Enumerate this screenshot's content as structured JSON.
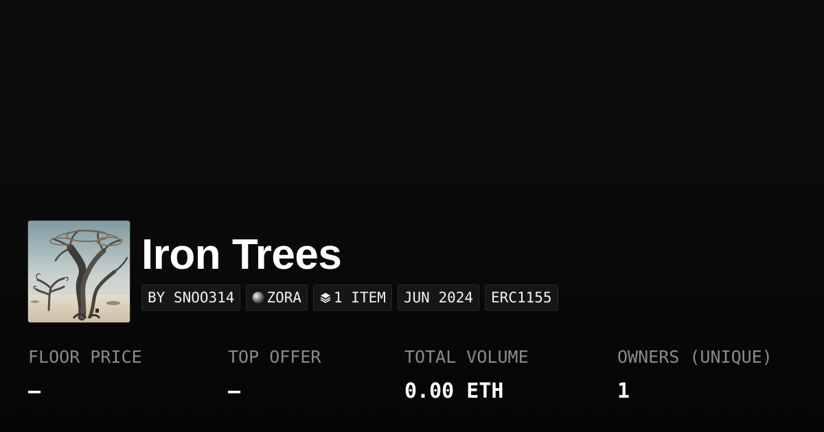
{
  "collection": {
    "name": "Iron Trees"
  },
  "tags": {
    "creator": "BY SNOO314",
    "chain": "ZORA",
    "items": "1 ITEM",
    "date": "JUN 2024",
    "standard": "ERC1155"
  },
  "icons": {
    "chain": "zora-orb-icon",
    "items": "layers-icon"
  },
  "stats": [
    {
      "label": "FLOOR PRICE",
      "value": "—"
    },
    {
      "label": "TOP OFFER",
      "value": "—"
    },
    {
      "label": "TOTAL VOLUME",
      "value": "0.00 ETH"
    },
    {
      "label": "OWNERS (UNIQUE)",
      "value": "1"
    }
  ],
  "colors": {
    "background": "#0a0a0a",
    "tag_background": "#161616",
    "label": "#8a8a8a",
    "value": "#ffffff"
  }
}
